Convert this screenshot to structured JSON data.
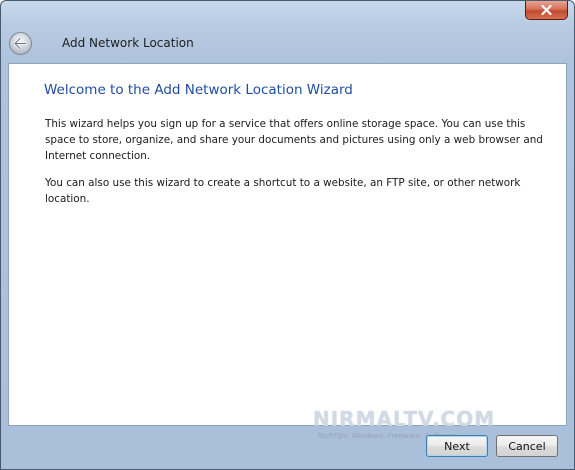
{
  "window": {
    "title": "Add Network Location"
  },
  "titlebar": {
    "back_icon": "back-arrow-icon",
    "close_icon": "close-x-icon",
    "close_color": "#c9553b"
  },
  "content": {
    "heading": "Welcome to the Add Network Location Wizard",
    "heading_color": "#1f4ea0",
    "paragraph_1": "This wizard helps you sign up for a service that offers online storage space.  You can use this space to store, organize, and share your documents and pictures using only a web browser and Internet connection.",
    "paragraph_2": "You can also use this wizard to create a shortcut to a website, an FTP site, or other network location."
  },
  "footer": {
    "next_label": "Next",
    "cancel_label": "Cancel"
  },
  "watermark": {
    "brand": "NIRMALTV.COM",
    "tagline": "TechTips, Windows, Freeware, Software..."
  }
}
